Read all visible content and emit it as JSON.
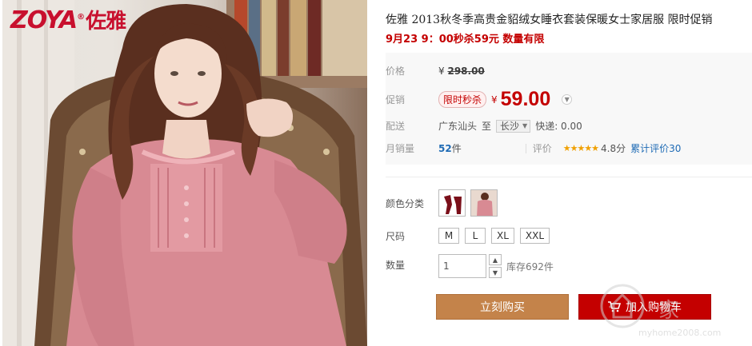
{
  "brand": {
    "logo_latin": "ZOYA",
    "logo_reg": "®",
    "logo_cn": "佐雅"
  },
  "product": {
    "title": "佐雅 2013秋冬季高贵金貂绒女睡衣套装保暖女士家居服 限时促销",
    "subtitle": "9月23 9：00秒杀59元 数量有限"
  },
  "pricing": {
    "original_label": "价格",
    "original_currency": "¥",
    "original_price": "298.00",
    "promo_label": "促销",
    "promo_tag": "限时秒杀",
    "promo_currency": "¥",
    "promo_price": "59.00"
  },
  "shipping": {
    "label": "配送",
    "from": "广东汕头",
    "to_word": "至",
    "destination": "长沙",
    "express": "快递: 0.00"
  },
  "sales": {
    "label": "月销量",
    "count": "52",
    "unit": "件",
    "review_label": "评价",
    "stars": "★★★★★",
    "rating": "4.8分",
    "review_count": "累计评价30"
  },
  "options": {
    "color_label": "颜色分类",
    "size_label": "尺码",
    "sizes": [
      "M",
      "L",
      "XL",
      "XXL"
    ],
    "qty_label": "数量",
    "qty_value": "1",
    "stock": "库存692件"
  },
  "actions": {
    "buy_now": "立刻购买",
    "add_to_cart": "加入购物车"
  },
  "watermark": {
    "text": "家",
    "url": "myhome2008.com"
  },
  "colors": {
    "accent_red": "#c40000",
    "buy_button": "#c4834a",
    "link_blue": "#1f6bb5",
    "star_gold": "#f0a000"
  }
}
